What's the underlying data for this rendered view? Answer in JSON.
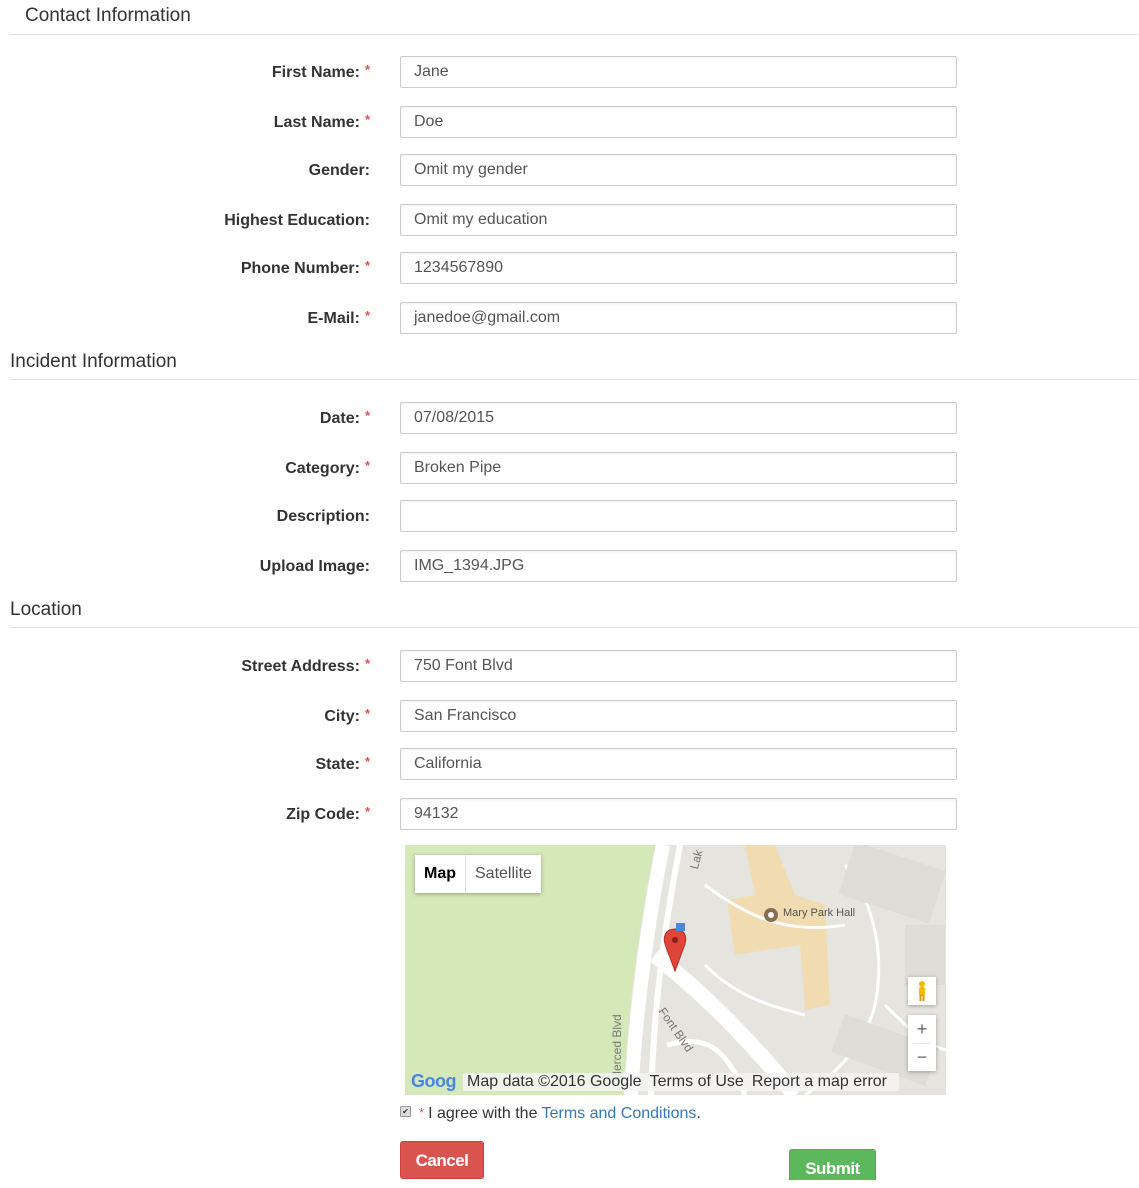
{
  "sections": {
    "contact": "Contact Information",
    "incident": "Incident Information",
    "location": "Location"
  },
  "required_mark": "*",
  "fields": {
    "first_name": {
      "label": "First Name:",
      "value": "Jane"
    },
    "last_name": {
      "label": "Last Name:",
      "value": "Doe"
    },
    "gender": {
      "label": "Gender:",
      "value": "Omit my gender"
    },
    "education": {
      "label": "Highest Education:",
      "value": "Omit my education"
    },
    "phone": {
      "label": "Phone Number:",
      "value": "1234567890"
    },
    "email": {
      "label": "E-Mail:",
      "value": "janedoe@gmail.com"
    },
    "date": {
      "label": "Date:",
      "value": "07/08/2015"
    },
    "category": {
      "label": "Category:",
      "value": "Broken Pipe"
    },
    "description": {
      "label": "Description:",
      "value": ""
    },
    "upload": {
      "label": "Upload Image:",
      "value": "IMG_1394.JPG"
    },
    "street": {
      "label": "Street Address:",
      "value": "750 Font Blvd"
    },
    "city": {
      "label": "City:",
      "value": "San Francisco"
    },
    "state": {
      "label": "State:",
      "value": "California"
    },
    "zip": {
      "label": "Zip Code:",
      "value": "94132"
    }
  },
  "map": {
    "type_map": "Map",
    "type_satellite": "Satellite",
    "poi": "Mary Park Hall",
    "street_merced": "Merced Blvd",
    "street_font": "Font Blvd",
    "street_lake": "Lak",
    "zoom_in": "+",
    "zoom_out": "−",
    "logo": "Goog",
    "attribution": "Map data ©2016 Google",
    "terms": "Terms of Use",
    "report": "Report a map error",
    "colors": {
      "park": "#d4e8b8",
      "building": "#f0dcb0",
      "road": "#ffffff",
      "marker": "#e0453a"
    }
  },
  "agree": {
    "prefix": "I agree with the ",
    "link": "Terms and Conditions",
    "suffix": ".",
    "checked": true
  },
  "buttons": {
    "cancel": "Cancel",
    "submit": "Submit",
    "cancel_color": "#d9534f",
    "submit_color": "#5cb85c"
  }
}
